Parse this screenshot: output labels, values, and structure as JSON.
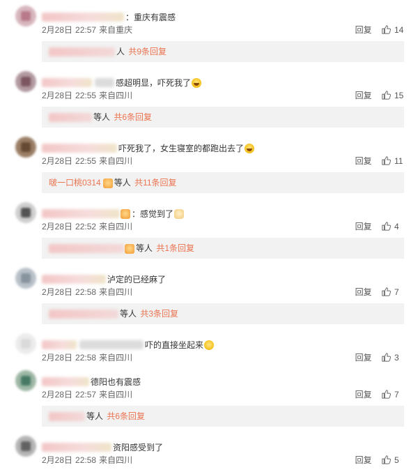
{
  "comments": [
    {
      "content": "：重庆有震感",
      "date": "2月28日",
      "time": "22:57",
      "location": "来自重庆",
      "reply_label": "回复",
      "likes": "14",
      "reply_summary": {
        "users_suffix": "人",
        "total": "共9条回复"
      }
    },
    {
      "content": "感超明显，吓死我了",
      "emoji": "crying-face",
      "date": "2月28日",
      "time": "22:55",
      "location": "来自四川",
      "reply_label": "回复",
      "likes": "15",
      "reply_summary": {
        "users_suffix": "等人",
        "total": "共6条回复"
      }
    },
    {
      "content": "吓死我了，女生寝室的都跑出去了",
      "emoji": "crying-face",
      "date": "2月28日",
      "time": "22:55",
      "location": "来自四川",
      "reply_label": "回复",
      "likes": "11",
      "reply_summary": {
        "first_user": "啵一口桃0314",
        "users_suffix": "等人",
        "total": "共11条回复",
        "emoji": "crown-badge"
      }
    },
    {
      "content": "：感觉到了",
      "date": "2月28日",
      "time": "22:52",
      "location": "来自四川",
      "reply_label": "回复",
      "likes": "4",
      "reply_summary": {
        "users_suffix": "等人",
        "total": "共1条回复"
      }
    },
    {
      "content": "泸定的已经麻了",
      "date": "2月28日",
      "time": "22:58",
      "location": "来自四川",
      "reply_label": "回复",
      "likes": "7",
      "reply_summary": {
        "users_suffix": "等人",
        "total": "共3条回复"
      }
    },
    {
      "content": "吓的直接坐起来",
      "emoji": "laughing-crying-face",
      "date": "2月28日",
      "time": "22:58",
      "location": "来自四川",
      "reply_label": "回复",
      "likes": "3"
    },
    {
      "content": "德阳也有震感",
      "date": "2月28日",
      "time": "22:57",
      "location": "来自四川",
      "reply_label": "回复",
      "likes": "7",
      "reply_summary": {
        "users_suffix": "等人",
        "total": "共6条回复"
      }
    },
    {
      "content": "资阳感受到了",
      "date": "2月28日",
      "time": "22:58",
      "location": "来自四川",
      "reply_label": "回复",
      "likes": "5"
    }
  ],
  "colors": {
    "accent": "#eb7350",
    "reply_bg": "#f2f2f2",
    "text": "#333333",
    "meta": "#666666"
  }
}
